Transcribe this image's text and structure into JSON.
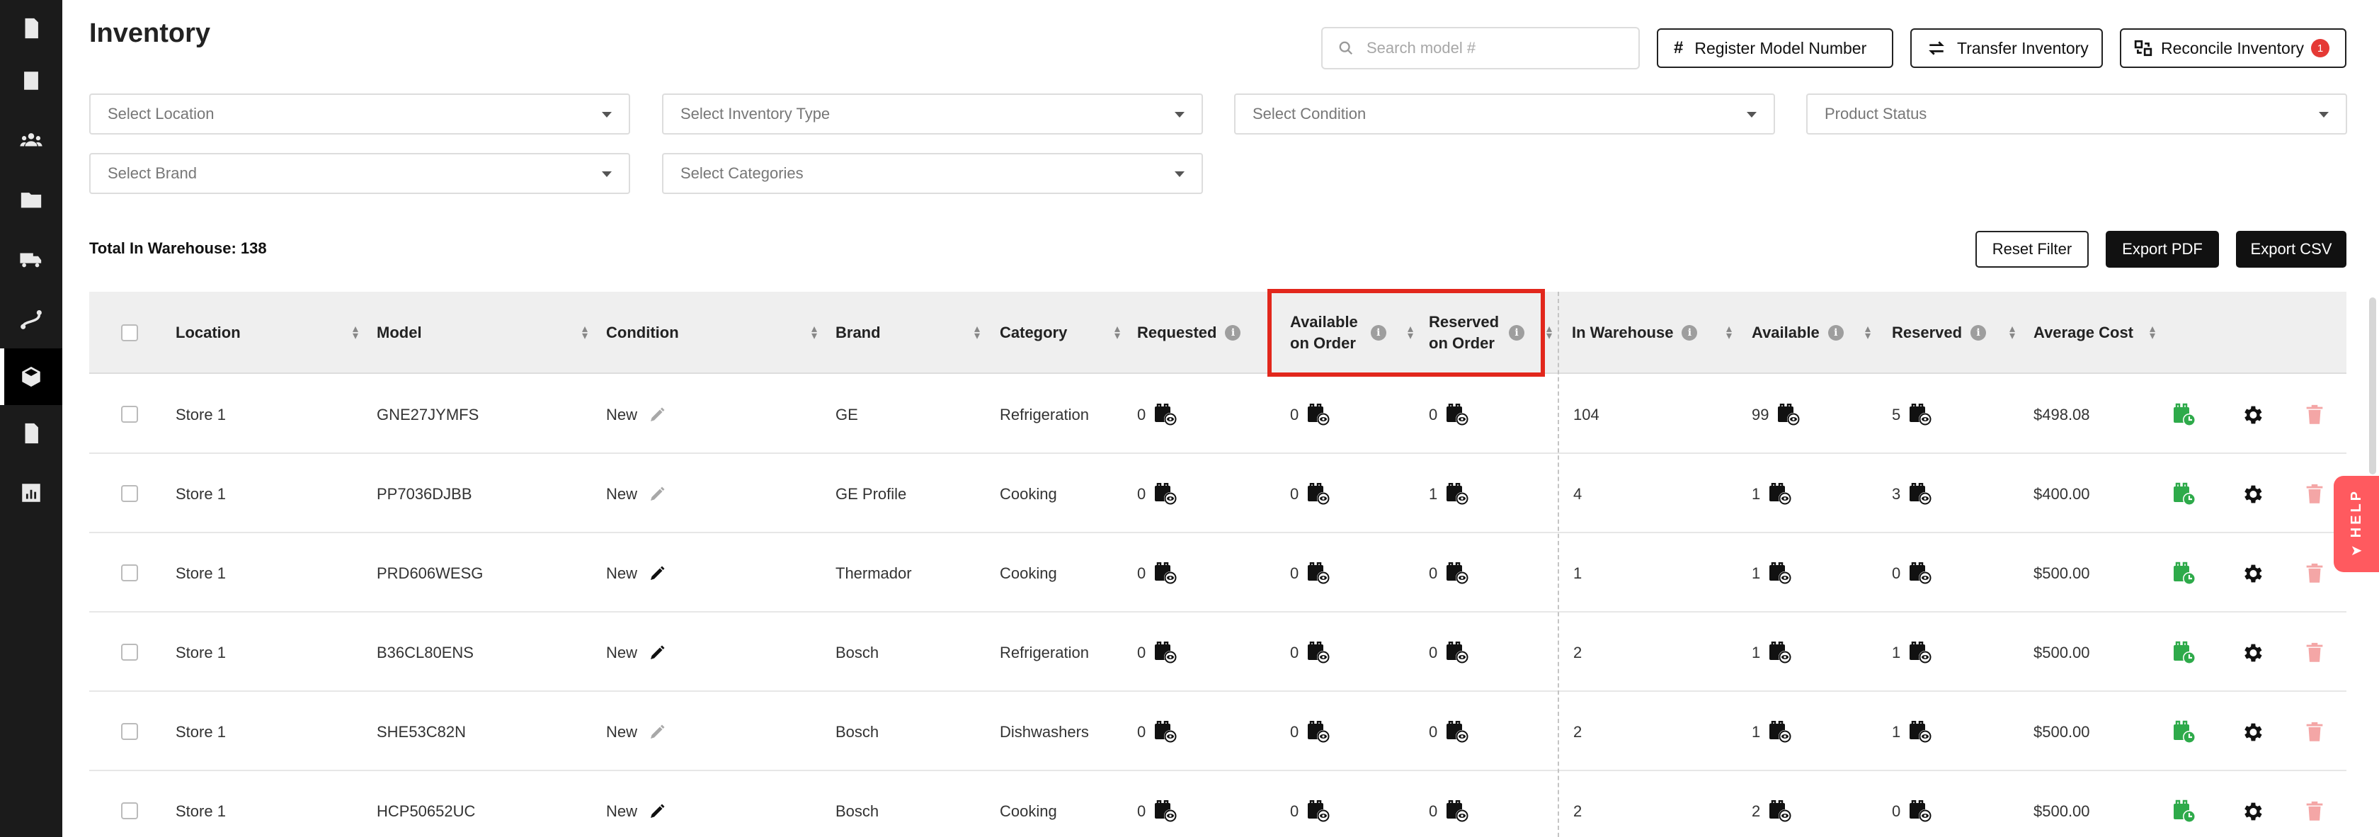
{
  "page": {
    "title": "Inventory"
  },
  "sidebar": {
    "items": [
      {
        "icon": "invoice-icon"
      },
      {
        "icon": "ledger-icon"
      },
      {
        "icon": "users-icon"
      },
      {
        "icon": "folder-icon"
      },
      {
        "icon": "truck-icon"
      },
      {
        "icon": "route-icon"
      },
      {
        "icon": "box-icon",
        "active": true
      },
      {
        "icon": "document-icon"
      },
      {
        "icon": "chart-icon"
      }
    ]
  },
  "header": {
    "search_placeholder": "Search model #",
    "register_label": "Register Model Number",
    "transfer_label": "Transfer Inventory",
    "reconcile_label": "Reconcile Inventory",
    "reconcile_badge": "1",
    "register_icon_text": "#"
  },
  "filters": {
    "location": "Select Location",
    "inventory_type": "Select Inventory Type",
    "condition": "Select Condition",
    "product_status": "Product Status",
    "brand": "Select Brand",
    "categories": "Select Categories"
  },
  "summary": {
    "total_label": "Total In Warehouse: 138",
    "reset_label": "Reset Filter",
    "export_pdf_label": "Export PDF",
    "export_csv_label": "Export CSV"
  },
  "table": {
    "columns": {
      "location": "Location",
      "model": "Model",
      "condition": "Condition",
      "brand": "Brand",
      "category": "Category",
      "requested": "Requested",
      "available_on_order_1": "Available",
      "available_on_order_2": "on Order",
      "reserved_on_order_1": "Reserved",
      "reserved_on_order_2": "on Order",
      "in_warehouse": "In Warehouse",
      "available": "Available",
      "reserved": "Reserved",
      "average_cost": "Average Cost"
    },
    "info_glyph": "i",
    "rows": [
      {
        "location": "Store 1",
        "model": "GNE27JYMFS",
        "condition": "New",
        "brand": "GE",
        "category": "Refrigeration",
        "requested": "0",
        "available_on_order": "0",
        "reserved_on_order": "0",
        "in_warehouse": "104",
        "available": "99",
        "reserved": "5",
        "average_cost": "$498.08"
      },
      {
        "location": "Store 1",
        "model": "PP7036DJBB",
        "condition": "New",
        "brand": "GE Profile",
        "category": "Cooking",
        "requested": "0",
        "available_on_order": "0",
        "reserved_on_order": "1",
        "in_warehouse": "4",
        "available": "1",
        "reserved": "3",
        "average_cost": "$400.00"
      },
      {
        "location": "Store 1",
        "model": "PRD606WESG",
        "condition": "New",
        "brand": "Thermador",
        "category": "Cooking",
        "requested": "0",
        "available_on_order": "0",
        "reserved_on_order": "0",
        "in_warehouse": "1",
        "available": "1",
        "reserved": "0",
        "average_cost": "$500.00"
      },
      {
        "location": "Store 1",
        "model": "B36CL80ENS",
        "condition": "New",
        "brand": "Bosch",
        "category": "Refrigeration",
        "requested": "0",
        "available_on_order": "0",
        "reserved_on_order": "0",
        "in_warehouse": "2",
        "available": "1",
        "reserved": "1",
        "average_cost": "$500.00"
      },
      {
        "location": "Store 1",
        "model": "SHE53C82N",
        "condition": "New",
        "brand": "Bosch",
        "category": "Dishwashers",
        "requested": "0",
        "available_on_order": "0",
        "reserved_on_order": "0",
        "in_warehouse": "2",
        "available": "1",
        "reserved": "1",
        "average_cost": "$500.00"
      },
      {
        "location": "Store 1",
        "model": "HCP50652UC",
        "condition": "New",
        "brand": "Bosch",
        "category": "Cooking",
        "requested": "0",
        "available_on_order": "0",
        "reserved_on_order": "0",
        "in_warehouse": "2",
        "available": "2",
        "reserved": "0",
        "average_cost": "$500.00"
      }
    ]
  },
  "help": {
    "label": "HELP",
    "arrow": "➤"
  },
  "colors": {
    "accent_green": "#2eaa4a",
    "delete_red": "#f4a6a6",
    "highlight_red": "#e2271c",
    "help_bg": "#ff5a5f"
  }
}
